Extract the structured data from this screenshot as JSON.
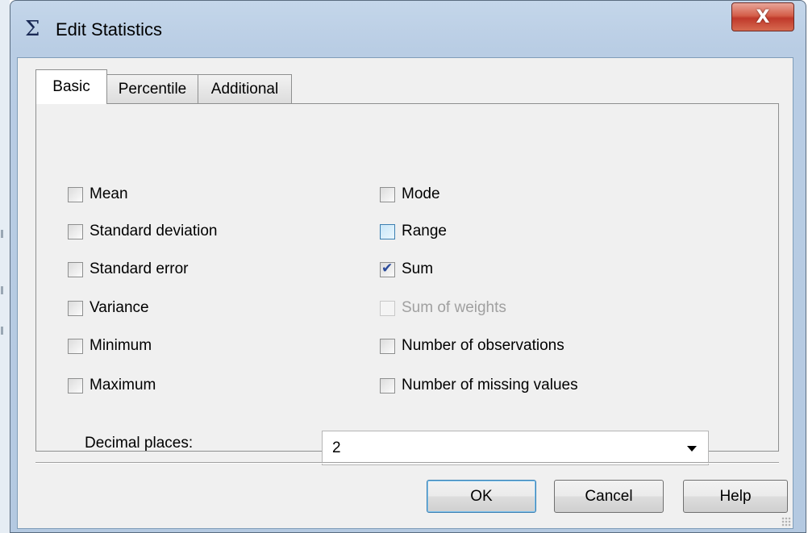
{
  "window": {
    "title": "Edit Statistics",
    "title_icon": "Σ",
    "close_label": "X"
  },
  "tabs": [
    {
      "label": "Basic",
      "active": true
    },
    {
      "label": "Percentile",
      "active": false
    },
    {
      "label": "Additional",
      "active": false
    }
  ],
  "statistics": {
    "left": [
      {
        "label": "Mean",
        "checked": false
      },
      {
        "label": "Standard deviation",
        "checked": false
      },
      {
        "label": "Standard error",
        "checked": false
      },
      {
        "label": "Variance",
        "checked": false
      },
      {
        "label": "Minimum",
        "checked": false
      },
      {
        "label": "Maximum",
        "checked": false
      }
    ],
    "right": [
      {
        "label": "Mode",
        "checked": false
      },
      {
        "label": "Range",
        "checked": false,
        "state": "hover"
      },
      {
        "label": "Sum",
        "checked": true
      },
      {
        "label": "Sum of weights",
        "checked": false,
        "enabled": false
      },
      {
        "label": "Number of observations",
        "checked": false
      },
      {
        "label": "Number of missing values",
        "checked": false
      }
    ]
  },
  "decimal_places": {
    "label": "Decimal places:",
    "value": "2"
  },
  "buttons": {
    "ok": "OK",
    "cancel": "Cancel",
    "help": "Help"
  },
  "colors": {
    "title_bar": "#b9cde4",
    "close_button": "#c0392b",
    "checkmark": "#2a4a9a",
    "default_button_border": "#3c7fb1"
  },
  "icons": [
    "sigma-icon",
    "close-icon",
    "checkmark-icon",
    "chevron-down-icon",
    "resize-grip-icon"
  ]
}
